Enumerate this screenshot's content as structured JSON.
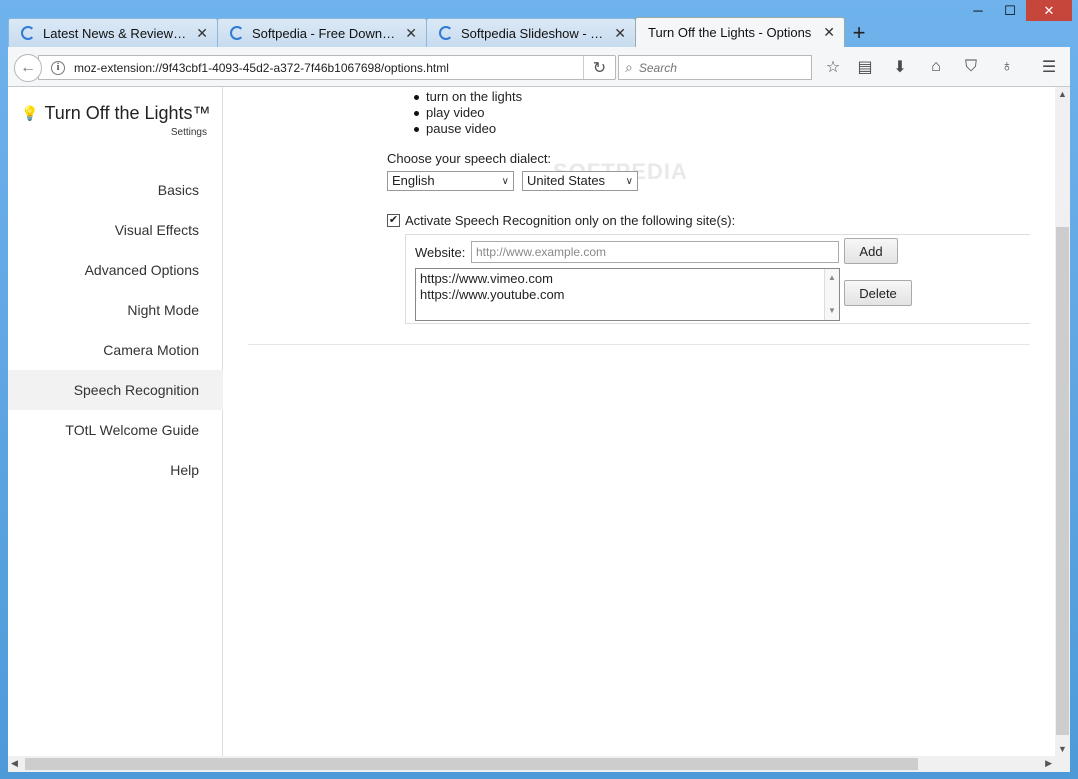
{
  "window": {
    "controls": {
      "minimize": "─",
      "maximize": "☐",
      "close": "✕"
    }
  },
  "tabs": [
    {
      "label": "Latest News & Reviews by...",
      "active": false,
      "loading": true
    },
    {
      "label": "Softpedia - Free Downloa...",
      "active": false,
      "loading": true
    },
    {
      "label": "Softpedia Slideshow - You...",
      "active": false,
      "loading": true
    },
    {
      "label": "Turn Off the Lights - Options",
      "active": true,
      "loading": false
    }
  ],
  "tab_close_glyph": "✕",
  "new_tab_glyph": "+",
  "navbar": {
    "url": "moz-extension://9f43cbf1-4093-45d2-a372-7f46b1067698/options.html",
    "search_placeholder": "Search",
    "info_glyph": "i"
  },
  "sidebar": {
    "title": "Turn Off the Lights™",
    "subtitle": "Settings",
    "items": [
      {
        "label": "Basics"
      },
      {
        "label": "Visual Effects"
      },
      {
        "label": "Advanced Options"
      },
      {
        "label": "Night Mode"
      },
      {
        "label": "Camera Motion"
      },
      {
        "label": "Speech Recognition",
        "active": true
      },
      {
        "label": "TOtL Welcome Guide"
      },
      {
        "label": "Help"
      }
    ]
  },
  "main": {
    "commands": [
      "turn on the lights",
      "play video",
      "pause video"
    ],
    "dialect_label": "Choose your speech dialect:",
    "language_select": "English",
    "region_select": "United States",
    "watermark": "SOFTPEDIA",
    "activate_checkbox_label": "Activate Speech Recognition only on the following site(s):",
    "activate_checked": true,
    "website_label": "Website:",
    "website_placeholder": "http://www.example.com",
    "add_button": "Add",
    "delete_button": "Delete",
    "sites": [
      "https://www.vimeo.com",
      "https://www.youtube.com"
    ]
  },
  "colors": {
    "frame": "#5aa4e3",
    "tab_spinner": "#2f7bd6",
    "close_button": "#c7463c"
  }
}
